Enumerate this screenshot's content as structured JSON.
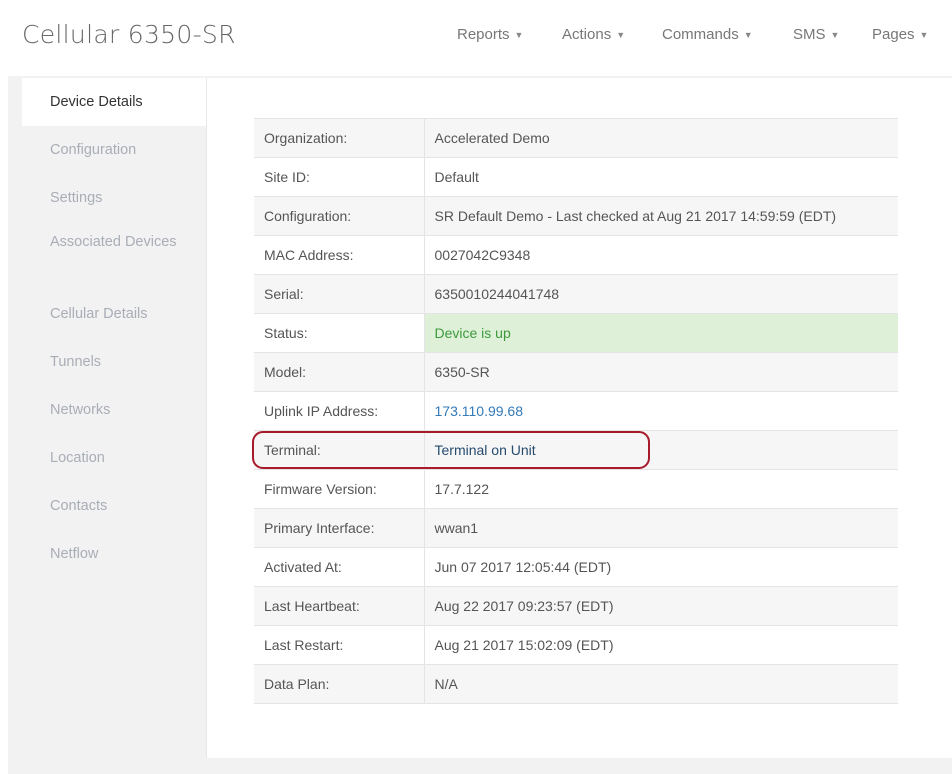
{
  "header": {
    "title": "Cellular 6350-SR",
    "nav": [
      {
        "label": "Reports"
      },
      {
        "label": "Actions"
      },
      {
        "label": "Commands"
      },
      {
        "label": "SMS"
      },
      {
        "label": "Pages"
      }
    ]
  },
  "sidebar": {
    "items": [
      {
        "label": "Device Details",
        "active": true
      },
      {
        "label": "Configuration"
      },
      {
        "label": "Settings"
      },
      {
        "label": "Associated Devices"
      },
      {
        "label": "Cellular Details"
      },
      {
        "label": "Tunnels"
      },
      {
        "label": "Networks"
      },
      {
        "label": "Location"
      },
      {
        "label": "Contacts"
      },
      {
        "label": "Netflow"
      }
    ]
  },
  "details": {
    "rows": [
      {
        "label": "Organization:",
        "value": "Accelerated Demo"
      },
      {
        "label": "Site ID:",
        "value": "Default"
      },
      {
        "label": "Configuration:",
        "value": "SR Default Demo - Last checked at Aug 21 2017 14:59:59 (EDT)"
      },
      {
        "label": "MAC Address:",
        "value": "0027042C9348"
      },
      {
        "label": "Serial:",
        "value": "6350010244041748"
      },
      {
        "label": "Status:",
        "value": "Device is up"
      },
      {
        "label": "Model:",
        "value": "6350-SR"
      },
      {
        "label": "Uplink IP Address:",
        "value": "173.110.99.68"
      },
      {
        "label": "Terminal:",
        "value": "Terminal on Unit"
      },
      {
        "label": "Firmware Version:",
        "value": "17.7.122"
      },
      {
        "label": "Primary Interface:",
        "value": "wwan1"
      },
      {
        "label": "Activated At:",
        "value": "Jun 07 2017 12:05:44 (EDT)"
      },
      {
        "label": "Last Heartbeat:",
        "value": "Aug 22 2017 09:23:57 (EDT)"
      },
      {
        "label": "Last Restart:",
        "value": "Aug 21 2017 15:02:09 (EDT)"
      },
      {
        "label": "Data Plan:",
        "value": "N/A"
      }
    ]
  },
  "colors": {
    "status_ok_bg": "#dff0d8",
    "status_ok_text": "#3c9a3c",
    "link": "#337ab7",
    "highlight_ring": "#a8192b"
  }
}
